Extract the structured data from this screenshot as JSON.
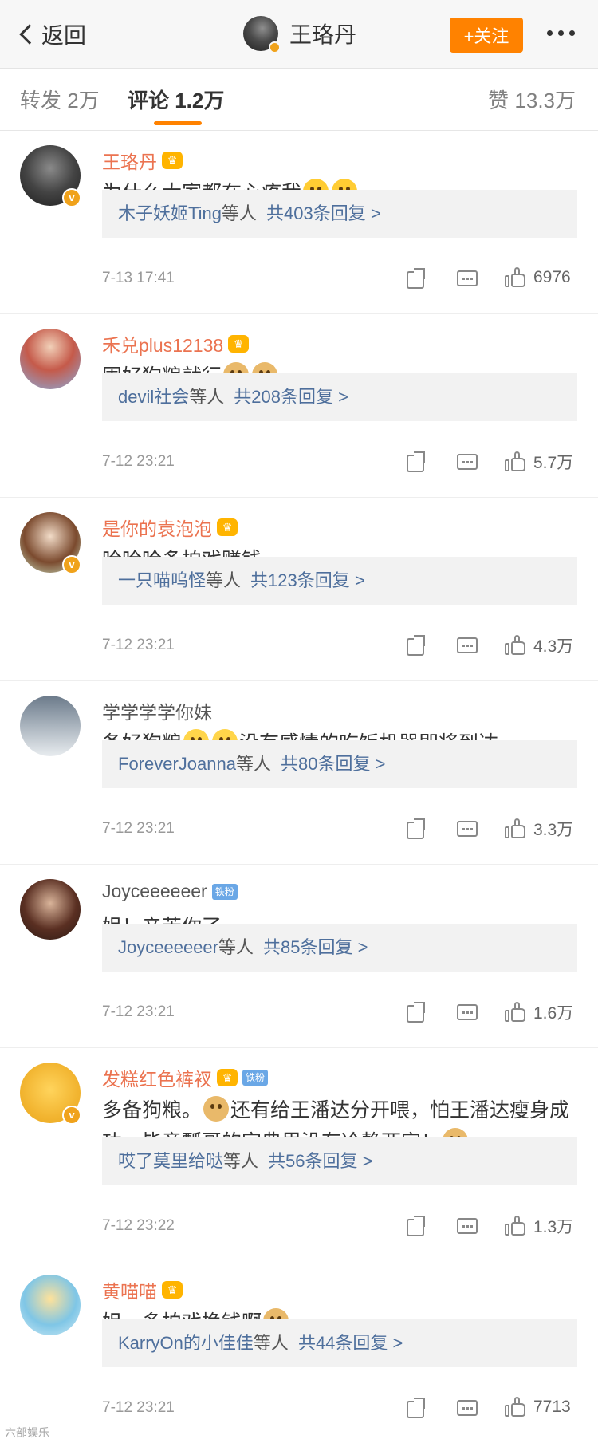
{
  "header": {
    "back_label": "返回",
    "title": "王珞丹",
    "follow_label": "+关注"
  },
  "tabs": {
    "repost": "转发 2万",
    "comments": "评论 1.2万",
    "likes": "赞 13.3万"
  },
  "colors": {
    "accent": "#ff8200",
    "username": "#eb7350",
    "link": "#4e6f9c"
  },
  "comments": [
    {
      "user": "王珞丹",
      "badge": "crown-icon",
      "text": "为什么大家都在心疼我",
      "reply_users": "木子妖姬Ting",
      "reply_etc": "等人",
      "reply_count": "共403条回复 >",
      "time": "7-13 17:41",
      "likes": "6976"
    },
    {
      "user": "禾兑plus12138",
      "badge": "crown-icon",
      "text": "囤好狗粮就行",
      "reply_users": "devil社会",
      "reply_etc": "等人",
      "reply_count": "共208条回复 >",
      "time": "7-12 23:21",
      "likes": "5.7万"
    },
    {
      "user": "是你的袁泡泡",
      "badge": "crown-icon",
      "text": "哈哈哈多拍戏赚钱。",
      "reply_users": "一只喵呜怪",
      "reply_etc": "等人",
      "reply_count": "共123条回复 >",
      "time": "7-12 23:21",
      "likes": "4.3万"
    },
    {
      "user": "学学学学你妹",
      "text_a": "备好狗粮",
      "text_b": "没有感情的吃饭机器即将到达",
      "reply_users": "ForeverJoanna",
      "reply_etc": "等人",
      "reply_count": "共80条回复 >",
      "time": "7-12 23:21",
      "likes": "3.3万"
    },
    {
      "user": "Joyceeeeeer",
      "fan_badge": "铁粉",
      "text": "姐！辛苦你了",
      "reply_users": "Joyceeeeeer",
      "reply_etc": "等人",
      "reply_count": "共85条回复 >",
      "time": "7-12 23:21",
      "likes": "1.6万"
    },
    {
      "user": "发糕红色裤衩",
      "fan_badge": "铁粉",
      "text_a": "多备狗粮。",
      "text_b": "还有给王潘达分开喂，怕王潘达瘦身成功。毕竟瓢哥的字典里没有冷静两字！",
      "reply_users": "哎了莫里给哒",
      "reply_etc": "等人",
      "reply_count": "共56条回复 >",
      "time": "7-12 23:22",
      "likes": "1.3万"
    },
    {
      "user": "黄喵喵",
      "text": "姐，多拍戏挣钱啊",
      "reply_users": "KarryOn的小佳佳",
      "reply_etc": "等人",
      "reply_count": "共44条回复 >",
      "time": "7-12 23:21",
      "likes": "7713"
    }
  ],
  "watermark": "六部娱乐"
}
